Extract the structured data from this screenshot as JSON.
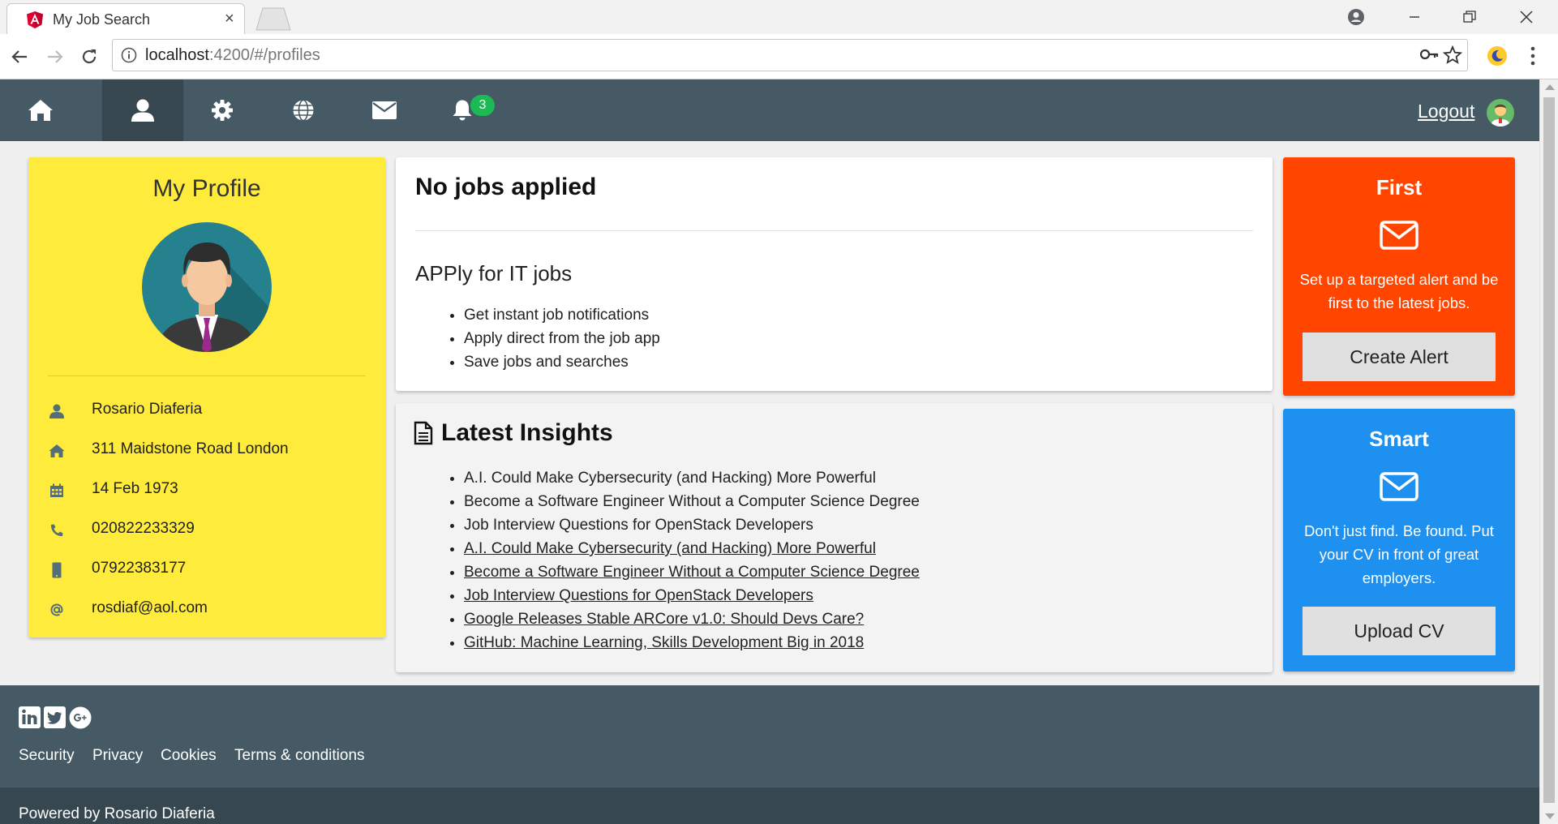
{
  "browser": {
    "tab_title": "My Job Search",
    "tab_close": "×",
    "url_host": "localhost",
    "url_rest": ":4200/#/profiles"
  },
  "nav": {
    "items": [
      {
        "icon": "home-icon"
      },
      {
        "icon": "user-icon",
        "active": true
      },
      {
        "icon": "gear-icon"
      },
      {
        "icon": "globe-icon"
      },
      {
        "icon": "envelope-icon"
      },
      {
        "icon": "bell-icon"
      }
    ],
    "notification_count": "3",
    "logout_label": "Logout"
  },
  "profile": {
    "title": "My Profile",
    "fields": [
      {
        "icon": "user-icon",
        "value": "Rosario Diaferia"
      },
      {
        "icon": "home-icon",
        "value": "311 Maidstone Road London"
      },
      {
        "icon": "calendar-icon",
        "value": "14 Feb 1973"
      },
      {
        "icon": "phone-icon",
        "value": "020822233329"
      },
      {
        "icon": "mobile-icon",
        "value": "07922383177"
      },
      {
        "icon": "at-icon",
        "value": "rosdiaf@aol.com"
      }
    ]
  },
  "jobs": {
    "title": "No jobs applied",
    "subtitle": "APPly for IT jobs",
    "bullets": [
      "Get instant job notifications",
      "Apply direct from the job app",
      "Save jobs and searches"
    ]
  },
  "insights": {
    "title": "Latest Insights",
    "items": [
      {
        "text": "A.I. Could Make Cybersecurity (and Hacking) More Powerful",
        "link": false
      },
      {
        "text": "Become a Software Engineer Without a Computer Science Degree",
        "link": false
      },
      {
        "text": "Job Interview Questions for OpenStack Developers",
        "link": false
      },
      {
        "text": "A.I. Could Make Cybersecurity (and Hacking) More Powerful",
        "link": true
      },
      {
        "text": "Become a Software Engineer Without a Computer Science Degree",
        "link": true
      },
      {
        "text": "Job Interview Questions for OpenStack Developers",
        "link": true
      },
      {
        "text": "Google Releases Stable ARCore v1.0: Should Devs Care?",
        "link": true
      },
      {
        "text": "GitHub: Machine Learning, Skills Development Big in 2018",
        "link": true
      }
    ]
  },
  "first": {
    "title": "First",
    "text": "Set up a targeted alert and be first to the latest jobs.",
    "button": "Create Alert",
    "color": "#ff4500"
  },
  "smart": {
    "title": "Smart",
    "text": "Don't just find. Be found. Put your CV in front of great employers.",
    "button": "Upload CV",
    "color": "#1e90f0"
  },
  "footer": {
    "social": [
      "linkedin-icon",
      "twitter-icon",
      "google-plus-icon"
    ],
    "links": [
      "Security",
      "Privacy",
      "Cookies",
      "Terms & conditions"
    ],
    "powered": "Powered by Rosario Diaferia"
  },
  "colors": {
    "navbar": "#455a64",
    "navbar_active": "#37474f",
    "profile_bg": "#ffeb3b",
    "badge": "#1db954"
  }
}
